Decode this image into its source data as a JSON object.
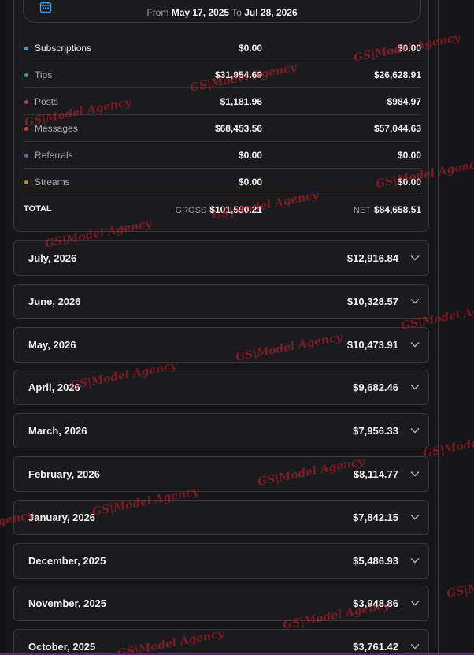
{
  "date_range": {
    "from_label": "From",
    "from_value": "May 17, 2025",
    "to_label": "To",
    "to_value": "Jul 28, 2026"
  },
  "earnings": [
    {
      "label": "Subscriptions",
      "gross": "$0.00",
      "net": "$0.00",
      "color": "#2ea3ff"
    },
    {
      "label": "Tips",
      "gross": "$31,954.69",
      "net": "$26,628.91",
      "color": "#1fa89a"
    },
    {
      "label": "Posts",
      "gross": "$1,181.96",
      "net": "$984.97",
      "color": "#c0336b"
    },
    {
      "label": "Messages",
      "gross": "$68,453.56",
      "net": "$57,044.63",
      "color": "#c0443a"
    },
    {
      "label": "Referrals",
      "gross": "$0.00",
      "net": "$0.00",
      "color": "#6a5ea8"
    },
    {
      "label": "Streams",
      "gross": "$0.00",
      "net": "$0.00",
      "color": "#c28a1a"
    }
  ],
  "total": {
    "label": "TOTAL",
    "gross_label": "GROSS",
    "gross": "$101,590.21",
    "net_label": "NET",
    "net": "$84,658.51"
  },
  "months": [
    {
      "name": "July, 2026",
      "amount": "$12,916.84"
    },
    {
      "name": "June, 2026",
      "amount": "$10,328.57"
    },
    {
      "name": "May, 2026",
      "amount": "$10,473.91"
    },
    {
      "name": "April, 2026",
      "amount": "$9,682.46"
    },
    {
      "name": "March, 2026",
      "amount": "$7,956.33"
    },
    {
      "name": "February, 2026",
      "amount": "$8,114.77"
    },
    {
      "name": "January, 2026",
      "amount": "$7,842.15"
    },
    {
      "name": "December, 2025",
      "amount": "$5,486.93"
    },
    {
      "name": "November, 2025",
      "amount": "$3,948.86"
    },
    {
      "name": "October, 2025",
      "amount": "$3,761.42"
    }
  ],
  "watermark": "GS|Model Agency",
  "icons": {
    "calendar": "calendar-icon",
    "expand": "chevron-down-icon"
  }
}
